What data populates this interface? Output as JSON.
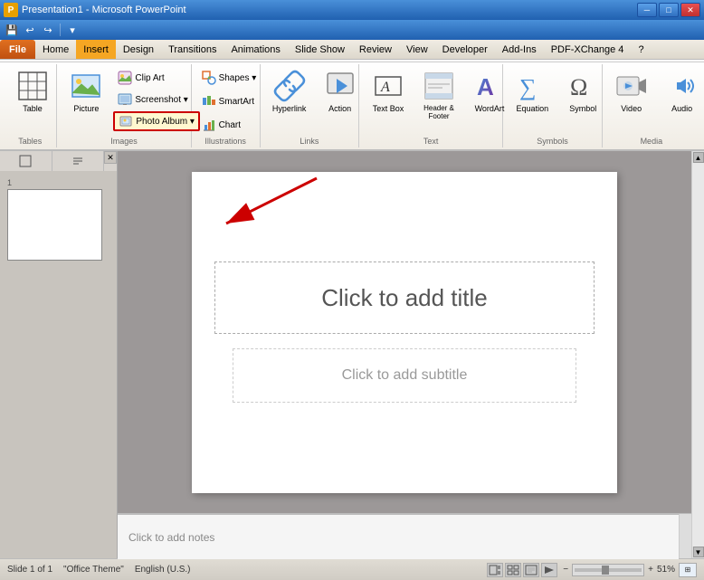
{
  "titlebar": {
    "title": "Presentation1 - Microsoft PowerPoint",
    "icon": "P",
    "minimize": "─",
    "restore": "□",
    "close": "✕"
  },
  "menubar": {
    "items": [
      "File",
      "Home",
      "Insert",
      "Design",
      "Transitions",
      "Animations",
      "Slide Show",
      "Review",
      "View",
      "Developer",
      "Add-Ins",
      "PDF-XChange 4",
      "?"
    ]
  },
  "quickaccess": {
    "buttons": [
      "💾",
      "↩",
      "↪"
    ]
  },
  "ribbon": {
    "tabs": [
      "Home",
      "Insert",
      "Design",
      "Transitions",
      "Animations",
      "Slide Show",
      "Review",
      "View",
      "Developer"
    ],
    "active_tab": "Insert",
    "groups": [
      {
        "name": "Tables",
        "label": "Tables",
        "buttons": [
          {
            "id": "table",
            "label": "Table",
            "icon": "⊞",
            "size": "large"
          }
        ]
      },
      {
        "name": "Images",
        "label": "Images",
        "buttons": [
          {
            "id": "picture",
            "label": "Picture",
            "icon": "🖼",
            "size": "large"
          },
          {
            "id": "clipart",
            "label": "Clip Art",
            "icon": "✂",
            "size": "small"
          },
          {
            "id": "screenshot",
            "label": "Screenshot ▾",
            "icon": "📷",
            "size": "small"
          },
          {
            "id": "photoalbum",
            "label": "Photo Album ▾",
            "icon": "📷",
            "size": "small",
            "highlighted": true
          }
        ]
      },
      {
        "name": "Illustrations",
        "label": "Illustrations",
        "buttons": [
          {
            "id": "shapes",
            "label": "Shapes ▾",
            "icon": "◻",
            "size": "small"
          },
          {
            "id": "smartart",
            "label": "SmartArt",
            "icon": "🔷",
            "size": "small"
          },
          {
            "id": "chart",
            "label": "Chart",
            "icon": "📊",
            "size": "small"
          }
        ]
      },
      {
        "name": "Links",
        "label": "Links",
        "buttons": [
          {
            "id": "hyperlink",
            "label": "Hyperlink",
            "icon": "🔗",
            "size": "large"
          },
          {
            "id": "action",
            "label": "Action",
            "icon": "▶",
            "size": "large"
          }
        ]
      },
      {
        "name": "Text",
        "label": "Text",
        "buttons": [
          {
            "id": "textbox",
            "label": "Text Box",
            "icon": "A",
            "size": "large"
          },
          {
            "id": "headerfooter",
            "label": "Header & Footer",
            "icon": "≡",
            "size": "large"
          },
          {
            "id": "wordart",
            "label": "WordArt",
            "icon": "A",
            "size": "large"
          }
        ]
      },
      {
        "name": "Symbols",
        "label": "Symbols",
        "buttons": [
          {
            "id": "equation",
            "label": "Equation",
            "icon": "∑",
            "size": "large"
          },
          {
            "id": "symbol",
            "label": "Symbol",
            "icon": "Ω",
            "size": "large"
          }
        ]
      },
      {
        "name": "Media",
        "label": "Media",
        "buttons": [
          {
            "id": "video",
            "label": "Video",
            "icon": "▶",
            "size": "large"
          },
          {
            "id": "audio",
            "label": "Audio",
            "icon": "♪",
            "size": "large"
          }
        ]
      }
    ]
  },
  "slide": {
    "title_placeholder": "Click to add title",
    "subtitle_placeholder": "Click to add subtitle",
    "notes_placeholder": "Click to add notes",
    "number": "1"
  },
  "statusbar": {
    "slide_info": "Slide 1 of 1",
    "theme": "\"Office Theme\"",
    "language": "English (U.S.)",
    "zoom": "51%"
  }
}
